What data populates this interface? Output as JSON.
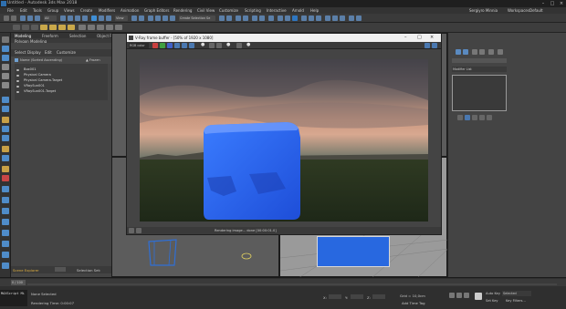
{
  "app": {
    "title": "Untitled - Autodesk 3ds Max 2018"
  },
  "menu": {
    "items": [
      "File",
      "Edit",
      "Tools",
      "Group",
      "Views",
      "Create",
      "Modifiers",
      "Animation",
      "Graph Editors",
      "Rendering",
      "Civil View",
      "Customize",
      "Scripting",
      "Interactive",
      "Arnold",
      "Help"
    ],
    "user": "Sergiyro Minnia",
    "workspaces_label": "Workspaces:",
    "workspace_value": "Default"
  },
  "toolbar": {
    "selection_dropdown": "All",
    "view_dropdown": "View",
    "create_selection_set": "Create Selection Se"
  },
  "ribbon": {
    "tabs": [
      "Modeling",
      "Freeform",
      "Selection",
      "Object Paint",
      "Populate"
    ],
    "subtitle": "Polygon Modeling"
  },
  "scene_explorer": {
    "tabs": [
      "Select",
      "Display",
      "Edit",
      "Customize"
    ],
    "column_header": "Name (Sorted Ascending)",
    "column_frozen": "▲ Frozen",
    "rows": [
      "Box001",
      "Physical Camera",
      "Physical Camera.Target",
      "VRaySun001",
      "VRaySun001.Target"
    ],
    "footer_label": "Scene Explorer",
    "selection_set_label": "Selection Set:"
  },
  "vfb": {
    "title": "V-Ray frame buffer - [50% of 1920 x 1080]",
    "channel": "RGB color",
    "status": "Rendering image... done [00:00:01.0]"
  },
  "right_panel": {
    "modifier_list": "Modifier List"
  },
  "status": {
    "maxscript": "MAXScript Mi",
    "selection": "None Selected",
    "render_time": "Rendering Time: 0:00:07",
    "frame_counter": "0 / 100",
    "x_label": "X:",
    "y_label": "Y:",
    "z_label": "Z:",
    "grid": "Grid = 10,0cm",
    "add_time_tag": "Add Time Tag",
    "auto_key": "Auto Key",
    "set_key": "Set Key",
    "selected": "Selected",
    "key_filters": "Key Filters..."
  }
}
